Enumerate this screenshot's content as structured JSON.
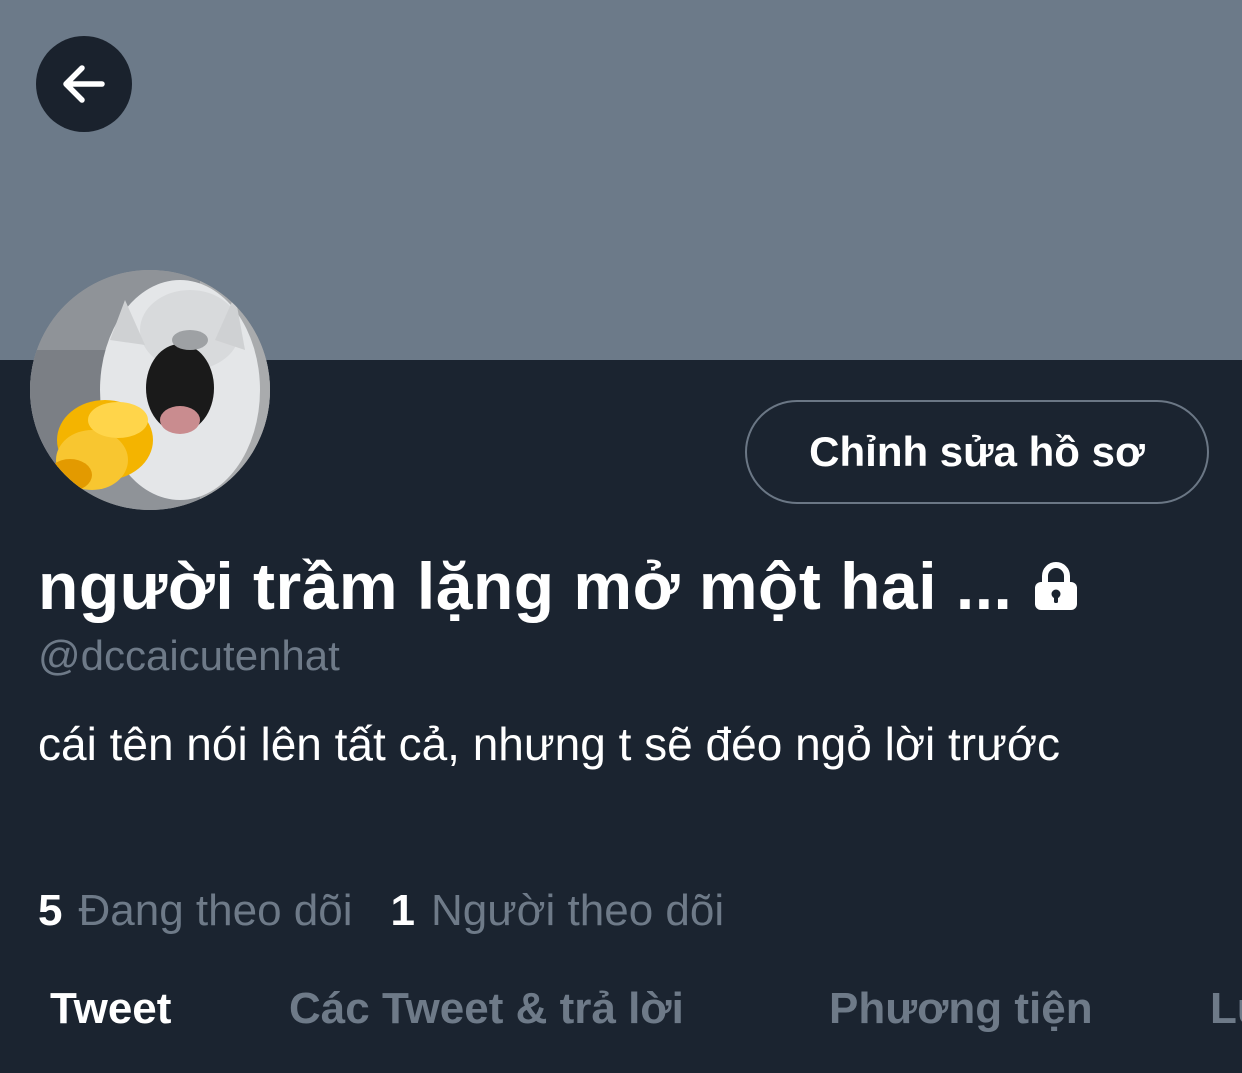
{
  "header": {
    "back_icon": "arrow-left-icon",
    "banner_color": "#6c7a89"
  },
  "profile": {
    "edit_label": "Chỉnh sửa hồ sơ",
    "display_name": "người trầm lặng mở một hai ...",
    "lock_icon": "lock-icon",
    "handle": "@dccaicutenhat",
    "bio": "cái tên nói lên tất cả, nhưng t sẽ đéo ngỏ lời trước"
  },
  "stats": {
    "following_count": "5",
    "following_label": "Đang theo dõi",
    "followers_count": "1",
    "followers_label": "Người theo dõi"
  },
  "tabs": [
    {
      "label": "Tweet",
      "active": true
    },
    {
      "label": "Các Tweet & trả lời",
      "active": false
    },
    {
      "label": "Phương tiện",
      "active": false
    },
    {
      "label": "Lư",
      "active": false
    }
  ],
  "colors": {
    "background": "#1b2430",
    "text_primary": "#ffffff",
    "text_secondary": "#6e7a88"
  }
}
